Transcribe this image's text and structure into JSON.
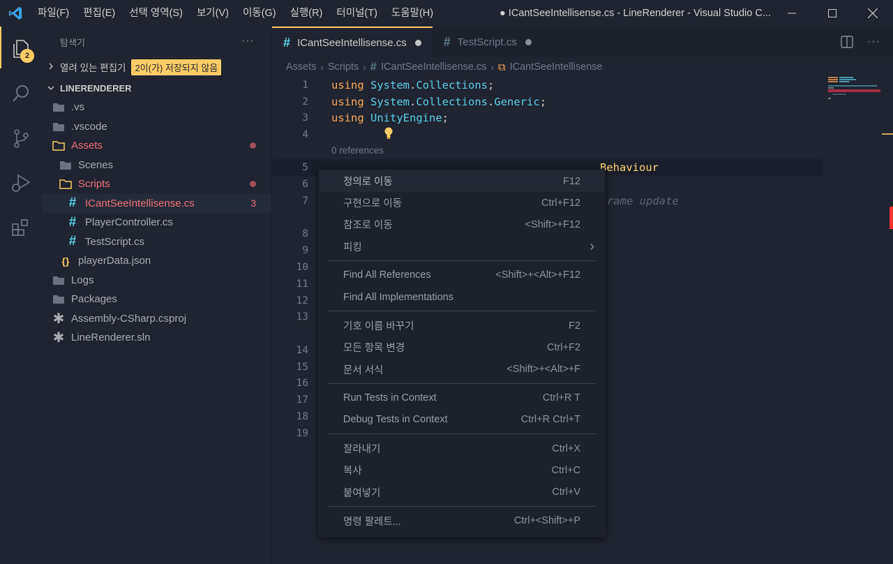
{
  "titlebar": {
    "menus": [
      "파일(F)",
      "편집(E)",
      "선택 영역(S)",
      "보기(V)",
      "이동(G)",
      "실행(R)",
      "터미널(T)",
      "도움말(H)"
    ],
    "window_title": "● ICantSeeIntellisense.cs - LineRenderer - Visual Studio C..."
  },
  "activity": {
    "explorer_badge": "2"
  },
  "sidebar": {
    "title": "탐색기",
    "open_editors_label": "열려 있는 편집기",
    "unsaved_badge": "2이(가) 저장되지 않음",
    "root": "LINERENDERER",
    "tree": [
      {
        "label": ".vs"
      },
      {
        "label": ".vscode"
      },
      {
        "label": "Assets"
      },
      {
        "label": "Scenes"
      },
      {
        "label": "Scripts"
      },
      {
        "label": "ICantSeeIntellisense.cs",
        "problems": "3"
      },
      {
        "label": "PlayerController.cs"
      },
      {
        "label": "TestScript.cs"
      },
      {
        "label": "playerData.json"
      },
      {
        "label": "Logs"
      },
      {
        "label": "Packages"
      },
      {
        "label": "Assembly-CSharp.csproj"
      },
      {
        "label": "LineRenderer.sln"
      }
    ]
  },
  "tabs": [
    {
      "label": "ICantSeeIntellisense.cs"
    },
    {
      "label": "TestScript.cs"
    }
  ],
  "breadcrumbs": [
    "Assets",
    "Scripts",
    "ICantSeeIntellisense.cs",
    "ICantSeeIntellisense"
  ],
  "code": {
    "line1": {
      "kw": "using",
      "ns1": "System",
      "ns2": "Collections"
    },
    "line2": {
      "kw": "using",
      "ns1": "System",
      "ns2": "Collections",
      "ns3": "Generic"
    },
    "line3": {
      "kw": "using",
      "ns1": "UnityEngine"
    },
    "codelens": "0 references",
    "line5_tail": "Behaviour",
    "line7_comment": "rame update",
    "line_numbers": [
      "1",
      "2",
      "3",
      "4",
      "5",
      "6",
      "7",
      "8",
      "9",
      "10",
      "11",
      "12",
      "13",
      "14",
      "15",
      "16",
      "17",
      "18",
      "19"
    ]
  },
  "context_menu": {
    "groups": [
      [
        {
          "label": "정의로 이동",
          "shortcut": "F12"
        },
        {
          "label": "구현으로 이동",
          "shortcut": "Ctrl+F12"
        },
        {
          "label": "참조로 이동",
          "shortcut": "<Shift>+F12"
        },
        {
          "label": "피킹",
          "shortcut": "›"
        }
      ],
      [
        {
          "label": "Find All References",
          "shortcut": "<Shift>+<Alt>+F12"
        },
        {
          "label": "Find All Implementations",
          "shortcut": ""
        }
      ],
      [
        {
          "label": "기호 이름 바꾸기",
          "shortcut": "F2"
        },
        {
          "label": "모든 항목 변경",
          "shortcut": "Ctrl+F2"
        },
        {
          "label": "문서 서식",
          "shortcut": "<Shift>+<Alt>+F"
        }
      ],
      [
        {
          "label": "Run Tests in Context",
          "shortcut": "Ctrl+R T"
        },
        {
          "label": "Debug Tests in Context",
          "shortcut": "Ctrl+R Ctrl+T"
        }
      ],
      [
        {
          "label": "잘라내기",
          "shortcut": "Ctrl+X"
        },
        {
          "label": "복사",
          "shortcut": "Ctrl+C"
        },
        {
          "label": "붙여넣기",
          "shortcut": "Ctrl+V"
        }
      ],
      [
        {
          "label": "명령 팔레트...",
          "shortcut": "Ctrl+<Shift>+P"
        }
      ]
    ]
  }
}
